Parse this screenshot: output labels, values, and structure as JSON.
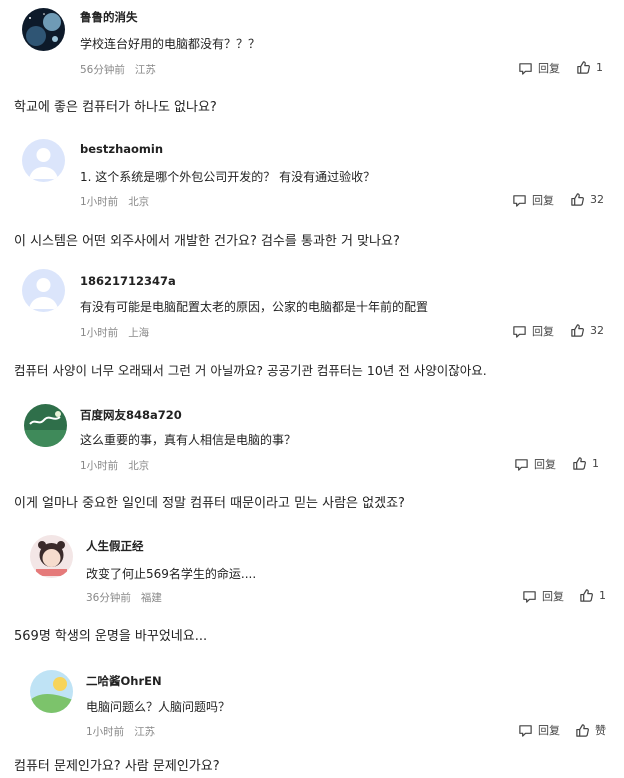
{
  "comments": [
    {
      "user": "鲁鲁的消失",
      "text": "学校连台好用的电脑都没有？？？",
      "time": "56分钟前",
      "location": "江苏",
      "reply_label": "回复",
      "likes": "1",
      "translation": "학교에 좋은 컴퓨터가 하나도 없나요?"
    },
    {
      "user": "bestzhaomin",
      "text": "1. 这个系统是哪个外包公司开发的？ 有没有通过验收？",
      "time": "1小时前",
      "location": "北京",
      "reply_label": "回复",
      "likes": "32",
      "translation": "이 시스템은 어떤 외주사에서 개발한 건가요? 검수를 통과한 거 맞나요?"
    },
    {
      "user": "18621712347a",
      "text": "有没有可能是电脑配置太老的原因，公家的电脑都是十年前的配置",
      "time": "1小时前",
      "location": "上海",
      "reply_label": "回复",
      "likes": "32",
      "translation": "컴퓨터 사양이 너무 오래돼서 그런 거 아닐까요? 공공기관 컴퓨터는 10년 전 사양이잖아요."
    },
    {
      "user": "百度网友848a720",
      "text": "这么重要的事，真有人相信是电脑的事？",
      "time": "1小时前",
      "location": "北京",
      "reply_label": "回复",
      "likes": "1",
      "translation": "이게 얼마나 중요한 일인데 정말 컴퓨터 때문이라고 믿는 사람은 없겠죠?"
    },
    {
      "user": "人生假正经",
      "text": "改变了何止569名学生的命运....",
      "time": "36分钟前",
      "location": "福建",
      "reply_label": "回复",
      "likes": "1",
      "translation": "569명 학생의 운명을 바꾸었네요..."
    },
    {
      "user": "二哈酱OhrEN",
      "text": "电脑问题么？人脑问题吗？",
      "time": "1小时前",
      "location": "江苏",
      "reply_label": "回复",
      "likes": "赞",
      "translation": "컴퓨터 문제인가요? 사람 문제인가요?"
    }
  ],
  "icons": {
    "reply": "comment-icon",
    "like": "thumbs-up-icon"
  },
  "colors": {
    "text": "#222222",
    "meta": "#888888",
    "avatar_default": "#c9d8f5"
  }
}
